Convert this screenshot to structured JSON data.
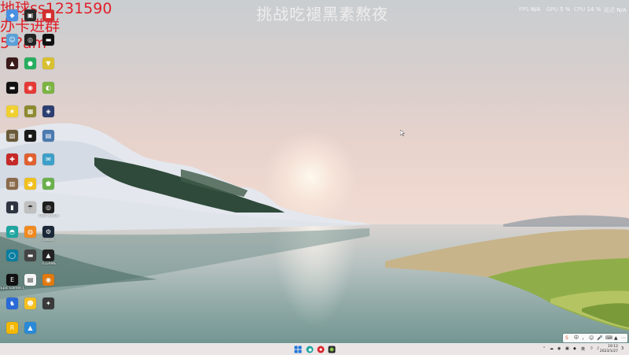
{
  "overlay": {
    "line1": "地球ss1231590",
    "line2": "办卡进群",
    "line3": "5-?am"
  },
  "stream_title": "挑战吃褪黑素熬夜",
  "perf": {
    "fps_label": "FPS",
    "fps_value": "N/A",
    "gpu_label": "GPU",
    "gpu_value": "5 %",
    "cpu_label": "CPU",
    "cpu_value": "14 %",
    "latency_label": "延迟",
    "latency_value": "N/A"
  },
  "desktop_icons": [
    {
      "name": "app-icon",
      "label": "",
      "color": "#4a90e2",
      "glyph": "◆"
    },
    {
      "name": "app-icon",
      "label": "",
      "color": "#2a2a2a",
      "glyph": "▣"
    },
    {
      "name": "app-icon",
      "label": "",
      "color": "#d32f2f",
      "glyph": "■"
    },
    {
      "name": "app-icon",
      "label": "",
      "color": "#5aa0d8",
      "glyph": "☺"
    },
    {
      "name": "app-icon",
      "label": "",
      "color": "#222222",
      "glyph": "◎"
    },
    {
      "name": "app-icon",
      "label": "",
      "color": "#111111",
      "glyph": "▬"
    },
    {
      "name": "app-icon",
      "label": "",
      "color": "#3a1a1a",
      "glyph": "▲"
    },
    {
      "name": "app-icon",
      "label": "",
      "color": "#27ae60",
      "glyph": "●"
    },
    {
      "name": "app-icon",
      "label": "",
      "color": "#d8c030",
      "glyph": "▼"
    },
    {
      "name": "app-icon",
      "label": "",
      "color": "#111111",
      "glyph": "▬"
    },
    {
      "name": "app-icon",
      "label": "",
      "color": "#e53935",
      "glyph": "◉"
    },
    {
      "name": "app-icon",
      "label": "",
      "color": "#7cb342",
      "glyph": "◐"
    },
    {
      "name": "app-icon",
      "label": "",
      "color": "#f0d030",
      "glyph": "★"
    },
    {
      "name": "app-icon",
      "label": "",
      "color": "#8e8a30",
      "glyph": "▦"
    },
    {
      "name": "app-icon",
      "label": "",
      "color": "#2c3e70",
      "glyph": "◈"
    },
    {
      "name": "app-icon",
      "label": "",
      "color": "#6a5a3a",
      "glyph": "▧"
    },
    {
      "name": "app-icon",
      "label": "",
      "color": "#1a1a1a",
      "glyph": "▪"
    },
    {
      "name": "app-icon",
      "label": "",
      "color": "#4a7ab0",
      "glyph": "▤"
    },
    {
      "name": "app-icon",
      "label": "",
      "color": "#c62828",
      "glyph": "✚"
    },
    {
      "name": "app-icon",
      "label": "",
      "color": "#e06030",
      "glyph": "⬢"
    },
    {
      "name": "app-icon",
      "label": "",
      "color": "#3da0c8",
      "glyph": "✉"
    },
    {
      "name": "app-icon",
      "label": "",
      "color": "#8a6a4a",
      "glyph": "▥"
    },
    {
      "name": "app-icon",
      "label": "",
      "color": "#f0c020",
      "glyph": "◕"
    },
    {
      "name": "app-icon",
      "label": "",
      "color": "#6ab04c",
      "glyph": "⬟"
    },
    {
      "name": "app-icon",
      "label": "",
      "color": "#2e3440",
      "glyph": "▮"
    },
    {
      "name": "app-icon",
      "label": "",
      "color": "#c0c0c0",
      "glyph": "☂"
    },
    {
      "name": "obs-studio-icon",
      "label": "OBS Studio",
      "color": "#1e1e1e",
      "glyph": "◎"
    },
    {
      "name": "edge-icon",
      "label": "",
      "color": "#1fa5a0",
      "glyph": "◓"
    },
    {
      "name": "app-icon",
      "label": "",
      "color": "#f08a20",
      "glyph": "◍"
    },
    {
      "name": "steam-icon",
      "label": "Steam",
      "color": "#1b2838",
      "glyph": "⚙"
    },
    {
      "name": "app-icon",
      "label": "",
      "color": "#0a7ea0",
      "glyph": "◯"
    },
    {
      "name": "app-icon",
      "label": "",
      "color": "#444444",
      "glyph": "▬"
    },
    {
      "name": "app-icon",
      "label": "TCGAME",
      "color": "#222222",
      "glyph": "▲"
    },
    {
      "name": "epic-games-icon",
      "label": "Epic Games Launcher",
      "color": "#111111",
      "glyph": "E"
    },
    {
      "name": "text-document-icon",
      "label": "",
      "color": "#f5f5f5",
      "glyph": "▤"
    },
    {
      "name": "app-icon",
      "label": "",
      "color": "#e07a10",
      "glyph": "◉"
    },
    {
      "name": "app-icon",
      "label": "",
      "color": "#2a6ad8",
      "glyph": "♞"
    },
    {
      "name": "app-icon",
      "label": "",
      "color": "#f5c020",
      "glyph": "☻"
    },
    {
      "name": "app-icon",
      "label": "",
      "color": "#3a3a3a",
      "glyph": "✦"
    },
    {
      "name": "rockstar-icon",
      "label": "",
      "color": "#f5b800",
      "glyph": "R"
    },
    {
      "name": "app-icon",
      "label": "",
      "color": "#2a8ad8",
      "glyph": "▲"
    }
  ],
  "taskbar": {
    "clock_time": "19:12",
    "clock_date": "2023/1/27",
    "tray_text": "英",
    "notification_count": "3"
  },
  "ime": {
    "a": "中",
    "b": "，",
    "c": "☺",
    "d": "🎤",
    "e": "⌨",
    "f": "▲",
    "g": "⋯"
  }
}
